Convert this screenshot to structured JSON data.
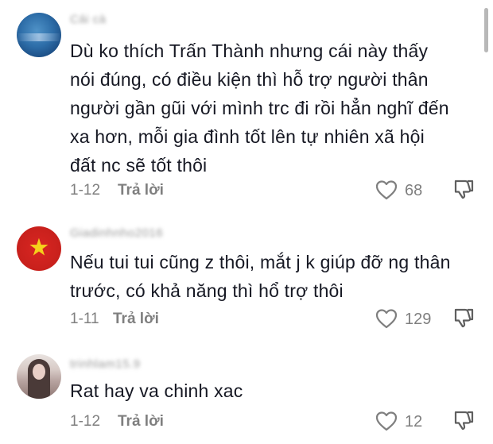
{
  "comments": [
    {
      "username": "Cá́i cà",
      "text_lines": [
        "Dù ko thích Trấn Thành nhưng cái này thấy",
        "nói đúng, có điều kiện thì hỗ trợ người thân",
        "người gần gũi với mình trc đi rồi hẳn nghĩ đến",
        "xa hơn, mỗi gia đình tốt lên tự nhiên xã hội",
        "đất nc sẽ tốt thôi"
      ],
      "date": "1-12",
      "reply_label": "Trả lời",
      "likes": "68",
      "avatar_icon": "sky-avatar-icon"
    },
    {
      "username": "Giadinhnho2016",
      "text_lines": [
        "Nếu tui tui cũng z thôi, mắt j k giúp đỡ ng thân",
        "trước, có khả năng thì hổ trợ thôi"
      ],
      "date": "1-11",
      "reply_label": "Trả lời",
      "likes": "129",
      "avatar_icon": "vietnam-flag-avatar-icon"
    },
    {
      "username": "trinhlam15.9",
      "text_lines": [
        "Rat hay va chinh xac"
      ],
      "date": "1-12",
      "reply_label": "Trả lời",
      "likes": "12",
      "avatar_icon": "photo-avatar-icon"
    }
  ],
  "colors": {
    "text": "#161823",
    "meta": "#7f7f7f",
    "flag_red": "#d92622",
    "flag_star": "#f5d21b"
  }
}
